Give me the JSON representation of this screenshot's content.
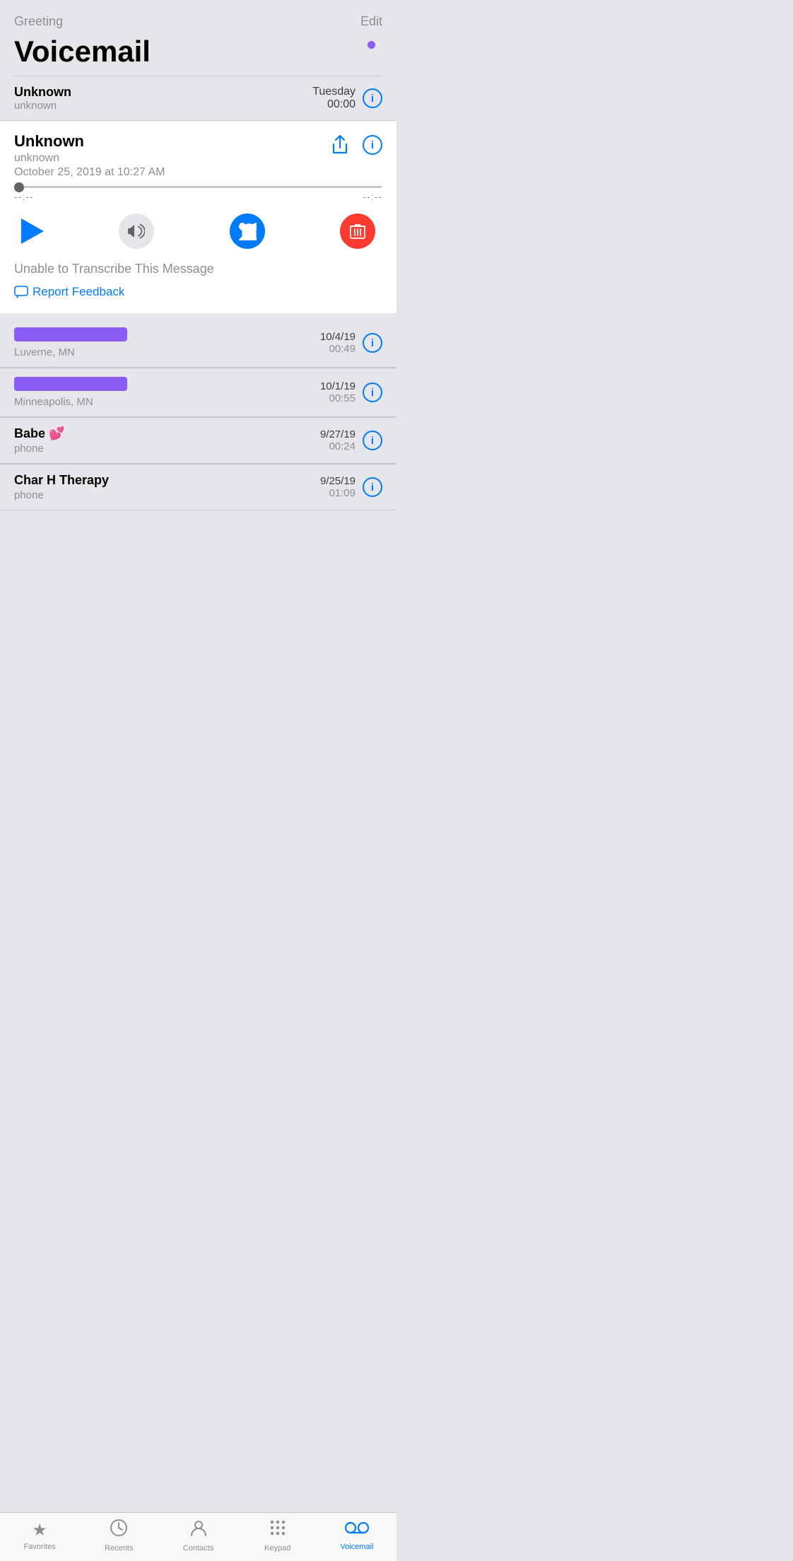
{
  "header": {
    "greeting_label": "Greeting",
    "edit_label": "Edit",
    "page_title": "Voicemail",
    "unread_dot": true
  },
  "first_item": {
    "name": "Unknown",
    "sub": "unknown",
    "date": "Tuesday",
    "time": "00:00"
  },
  "detail": {
    "name": "Unknown",
    "sub": "unknown",
    "date": "October 25, 2019 at 10:27 AM",
    "time_start": "--:--",
    "time_end": "--:--",
    "transcription_text": "Unable to Transcribe This Message",
    "report_feedback_label": "Report Feedback"
  },
  "voicemail_items": [
    {
      "name_redacted": true,
      "name_width": 160,
      "sub": "Luverne, MN",
      "date": "10/4/19",
      "time": "00:49"
    },
    {
      "name_redacted": true,
      "name_width": 160,
      "sub": "Minneapolis, MN",
      "date": "10/1/19",
      "time": "00:55"
    },
    {
      "name": "Babe 💕",
      "name_redacted": false,
      "sub": "phone",
      "date": "9/27/19",
      "time": "00:24"
    },
    {
      "name": "Char H Therapy",
      "name_redacted": false,
      "sub": "phone",
      "date": "9/25/19",
      "time": "01:09"
    }
  ],
  "tabs": [
    {
      "label": "Favorites",
      "icon": "★",
      "active": false
    },
    {
      "label": "Recents",
      "icon": "🕐",
      "active": false
    },
    {
      "label": "Contacts",
      "icon": "👤",
      "active": false
    },
    {
      "label": "Keypad",
      "icon": "⠿",
      "active": false
    },
    {
      "label": "Voicemail",
      "icon": "📻",
      "active": true
    }
  ]
}
